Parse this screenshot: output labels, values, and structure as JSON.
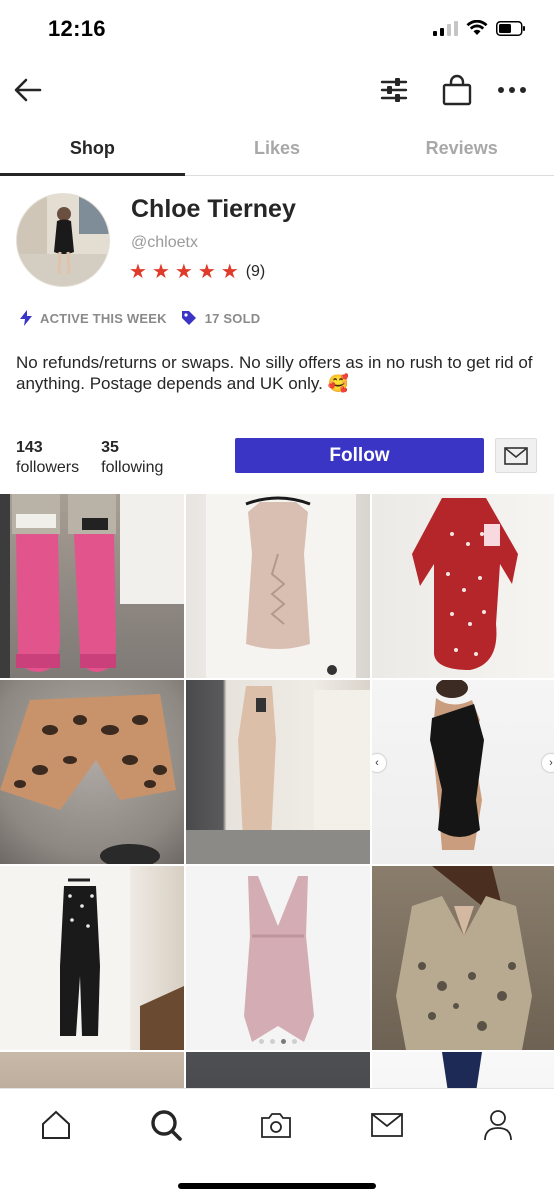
{
  "status_bar": {
    "time": "12:16"
  },
  "tabs": [
    {
      "label": "Shop",
      "active": true
    },
    {
      "label": "Likes",
      "active": false
    },
    {
      "label": "Reviews",
      "active": false
    }
  ],
  "profile": {
    "name": "Chloe Tierney",
    "handle": "@chloetx",
    "rating_stars": 5,
    "rating_count": "(9)",
    "badges": [
      {
        "icon": "lightning-icon",
        "label": "ACTIVE THIS WEEK"
      },
      {
        "icon": "tag-icon",
        "label": "17 SOLD"
      }
    ],
    "bio": "No refunds/returns or swaps. No silly offers as in no rush to get rid of anything. Postage depends and UK only. 🥰",
    "followers_count": "143",
    "followers_label": "followers",
    "following_count": "35",
    "following_label": "following",
    "follow_button": "Follow"
  },
  "colors": {
    "accent": "#3a35c4",
    "star": "#e03a2b",
    "badge_icon": "#3a35c4"
  },
  "listings": [
    {
      "name": "pink-wellington-boots"
    },
    {
      "name": "nude-lace-up-dress"
    },
    {
      "name": "red-polka-dot-dress"
    },
    {
      "name": "leopard-print-shorts"
    },
    {
      "name": "nude-jumpsuit"
    },
    {
      "name": "black-one-shoulder-dress",
      "has_carousel": true
    },
    {
      "name": "polka-dot-jumpsuit"
    },
    {
      "name": "pink-wrap-dress",
      "has_dots": true
    },
    {
      "name": "sequin-dress"
    },
    {
      "name": "partial-listing-10"
    },
    {
      "name": "partial-listing-11"
    },
    {
      "name": "partial-listing-12"
    }
  ],
  "bottom_nav": [
    "home-icon",
    "search-icon",
    "camera-icon",
    "mail-icon",
    "profile-icon"
  ]
}
